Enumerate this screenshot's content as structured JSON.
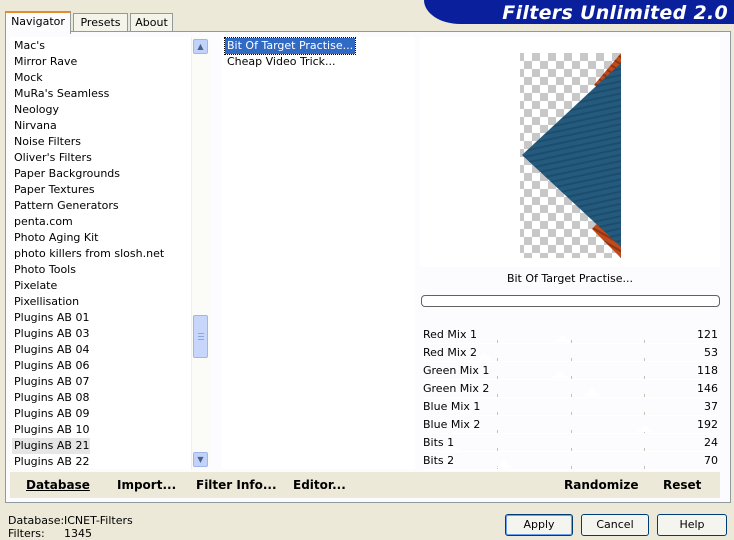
{
  "tabs": [
    {
      "label": "Navigator",
      "active": true
    },
    {
      "label": "Presets",
      "active": false
    },
    {
      "label": "About",
      "active": false
    }
  ],
  "banner": {
    "title": "Filters Unlimited 2.0",
    "color": "#0a1f9c"
  },
  "categories": [
    "Mac's",
    "Mirror Rave",
    "Mock",
    "MuRa's Seamless",
    "Neology",
    "Nirvana",
    "Noise Filters",
    "Oliver's Filters",
    "Paper Backgrounds",
    "Paper Textures",
    "Pattern Generators",
    "penta.com",
    "Photo Aging Kit",
    "photo killers from slosh.net",
    "Photo Tools",
    "Pixelate",
    "Pixellisation",
    "Plugins AB 01",
    "Plugins AB 03",
    "Plugins AB 04",
    "Plugins AB 06",
    "Plugins AB 07",
    "Plugins AB 08",
    "Plugins AB 09",
    "Plugins AB 10",
    "Plugins AB 21",
    "Plugins AB 22"
  ],
  "selected_category": "Plugins AB 21",
  "scrollbar_icons": {
    "up": "arrow-up-icon",
    "down": "arrow-down-icon"
  },
  "filters": [
    "Bit Of Target Practise...",
    "Cheap Video Trick..."
  ],
  "selected_filter": "Bit Of Target Practise...",
  "preview": {
    "filter_name": "Bit Of Target Practise...",
    "progress": 0
  },
  "sliders": [
    {
      "label": "Red Mix 1",
      "value": 121
    },
    {
      "label": "Red Mix 2",
      "value": 53
    },
    {
      "label": "Green Mix 1",
      "value": 118
    },
    {
      "label": "Green Mix 2",
      "value": 146
    },
    {
      "label": "Blue Mix 1",
      "value": 37
    },
    {
      "label": "Blue Mix 2",
      "value": 192
    },
    {
      "label": "Bits 1",
      "value": 24
    },
    {
      "label": "Bits 2",
      "value": 70
    }
  ],
  "toolbar": {
    "database": "Database",
    "import": "Import...",
    "filter_info": "Filter Info...",
    "editor": "Editor...",
    "randomize": "Randomize",
    "reset": "Reset"
  },
  "footer": {
    "database_label": "Database:",
    "database_value": "ICNET-Filters",
    "filters_label": "Filters:",
    "filters_value": "1345"
  },
  "buttons": {
    "apply": "Apply",
    "cancel": "Cancel",
    "help": "Help"
  },
  "colors": {
    "accent": "#e68b2c",
    "selection": "#316ac5",
    "preview_blue": "#245a7e",
    "preview_orange": "#c04a1a"
  }
}
